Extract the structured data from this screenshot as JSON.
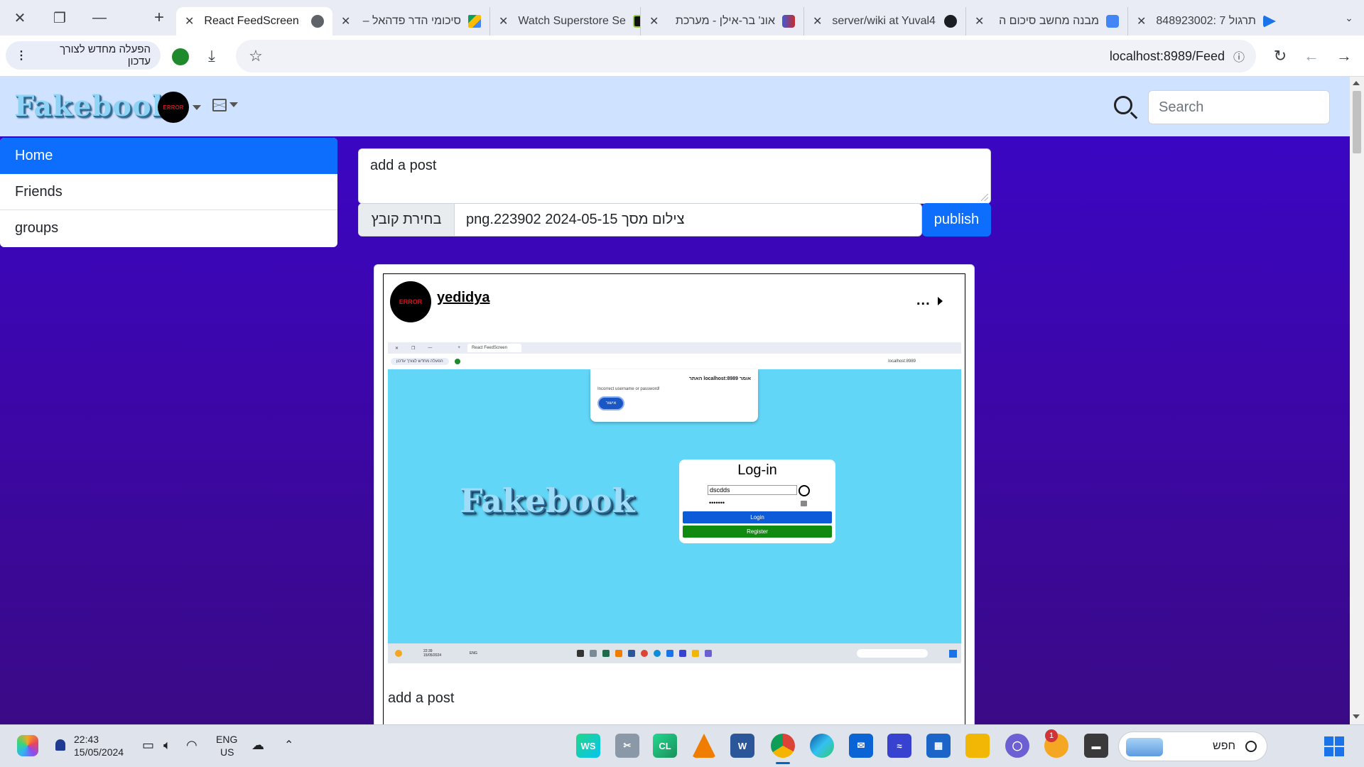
{
  "browser": {
    "tabs": [
      {
        "title": "React FeedScreen",
        "active": true,
        "icon": "globe-icon"
      },
      {
        "title": "סיכומי הדר פדהאל –",
        "icon": "drive-icon"
      },
      {
        "title": "Watch Superstore Se",
        "icon": "site-icon"
      },
      {
        "title": "אונ' בר-אילן - מערכת",
        "icon": "site-icon"
      },
      {
        "title": "server/wiki at Yuval4",
        "icon": "github-icon"
      },
      {
        "title": "מבנה מחשב סיכום ה",
        "icon": "docs-icon"
      },
      {
        "title": "תרגול 7 :848923002",
        "icon": "site-icon"
      }
    ],
    "update_pill": "הפעלה מחדש לצורך עדכון",
    "url": "localhost:8989/Feed"
  },
  "app": {
    "logo": "Fakebook",
    "avatar_text": "ERROR",
    "search_placeholder": "Search",
    "sidebar": [
      "Home",
      "Friends",
      "groups"
    ],
    "composer_text": "add a post",
    "file_button": "בחירת קובץ",
    "file_name": "צילום מסך 2024-05-15 223902.png",
    "publish_label": "publish",
    "post": {
      "author": "yedidya",
      "menu": "...",
      "text": "add a post",
      "image": {
        "alert_title": "האתר localhost:8989 אומר",
        "alert_message": "Incorrect username or password!",
        "alert_ok": "אישור",
        "logo": "Fakebook",
        "login_title": "Log-in",
        "username": "dscdds",
        "password": "•••••••",
        "login_btn": "Login",
        "register_btn": "Register",
        "mini_url": "localhost:8989",
        "mini_tab": "React FeedScreen",
        "mini_update": "הפעלה מחדש לצורך עדכון",
        "mini_time": "22:39",
        "mini_date": "15/05/2024",
        "mini_lang": "ENG"
      }
    }
  },
  "taskbar": {
    "time": "22:43",
    "date": "15/05/2024",
    "lang_line1": "ENG",
    "lang_line2": "US",
    "search_placeholder": "חפש",
    "notification_count": "1"
  }
}
